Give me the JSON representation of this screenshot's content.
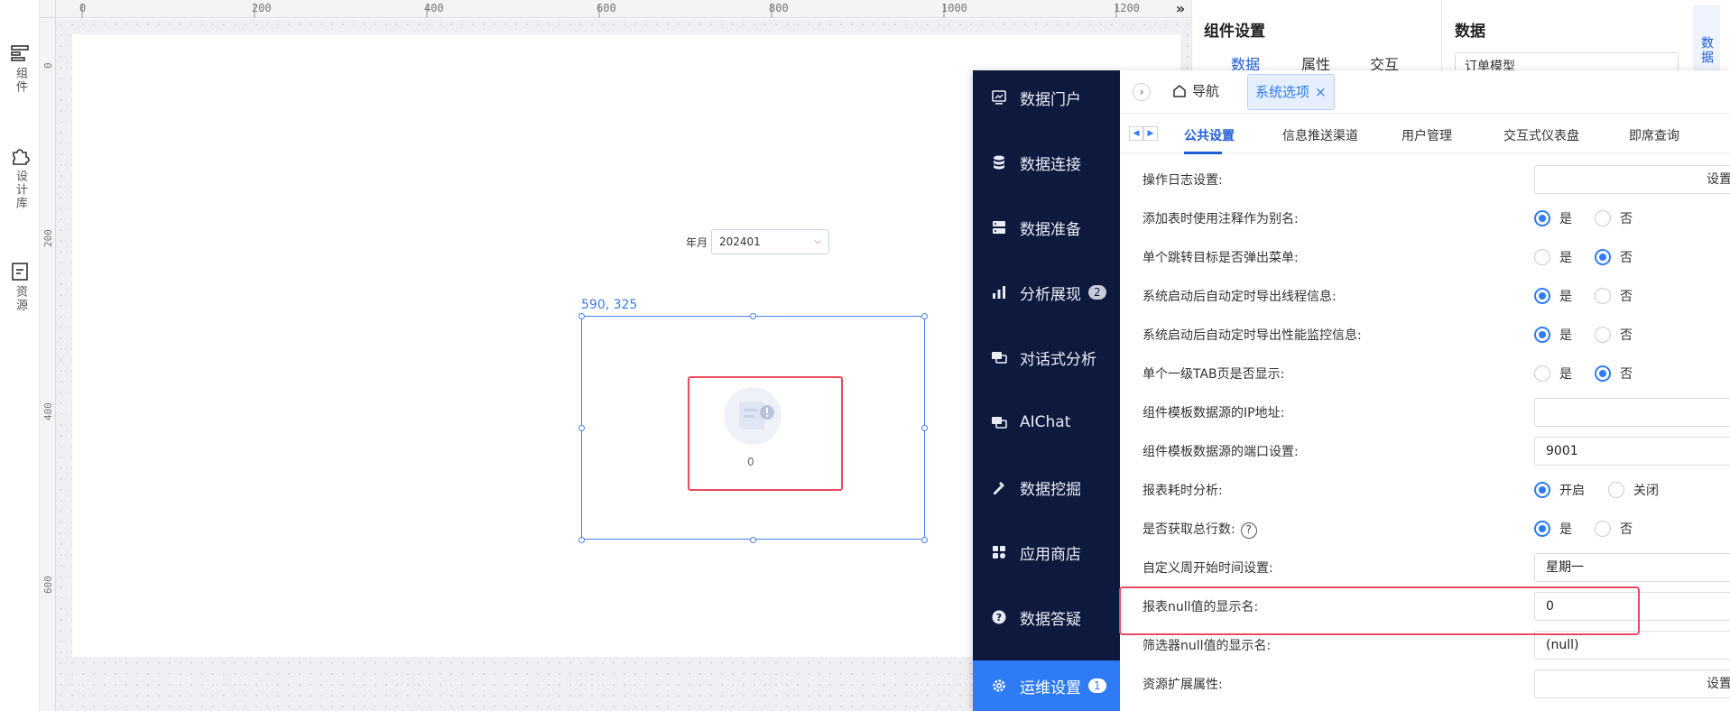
{
  "rail": {
    "items": [
      {
        "label": "组件",
        "icon": "component-icon"
      },
      {
        "label": "设计库",
        "icon": "puzzle-icon"
      },
      {
        "label": "资源",
        "icon": "resource-icon"
      }
    ]
  },
  "ruler": {
    "top_ticks": [
      "0",
      "200",
      "400",
      "600",
      "800",
      "1000",
      "1200"
    ],
    "left_ticks": [
      "0",
      "200",
      "400",
      "600"
    ],
    "collapse": "»"
  },
  "canvas": {
    "filter_label": "年月",
    "filter_value": "202401",
    "coord_readout": "590, 325",
    "widget_value": "0"
  },
  "props": {
    "title": "组件设置",
    "tabs": [
      "数据",
      "属性",
      "交互"
    ],
    "data_title": "数据",
    "data_model": "订单模型",
    "side_tab": "数据"
  },
  "sidenav": {
    "items": [
      {
        "label": "数据门户",
        "icon": "portal-icon",
        "badge": ""
      },
      {
        "label": "数据连接",
        "icon": "database-icon",
        "badge": ""
      },
      {
        "label": "数据准备",
        "icon": "server-icon",
        "badge": ""
      },
      {
        "label": "分析展现",
        "icon": "bar-chart-icon",
        "badge": "2"
      },
      {
        "label": "对话式分析",
        "icon": "chat-icon",
        "badge": ""
      },
      {
        "label": "AIChat",
        "icon": "ai-chat-icon",
        "badge": ""
      },
      {
        "label": "数据挖掘",
        "icon": "pickaxe-icon",
        "badge": ""
      },
      {
        "label": "应用商店",
        "icon": "app-store-icon",
        "badge": ""
      },
      {
        "label": "数据答疑",
        "icon": "question-icon",
        "badge": ""
      },
      {
        "label": "运维设置",
        "icon": "gear-icon",
        "badge": "1"
      }
    ]
  },
  "topbar": {
    "nav_label": "导航",
    "active_tab": "系统选项",
    "close": "×"
  },
  "subtabs": [
    "公共设置",
    "信息推送渠道",
    "用户管理",
    "交互式仪表盘",
    "即席查询"
  ],
  "settings": {
    "op_log": {
      "label": "操作日志设置:",
      "button": "设置"
    },
    "alias": {
      "label": "添加表时使用注释作为别名:",
      "yes": "是",
      "no": "否"
    },
    "jump_menu": {
      "label": "单个跳转目标是否弹出菜单:",
      "yes": "是",
      "no": "否"
    },
    "thread_export": {
      "label": "系统启动后自动定时导出线程信息:",
      "yes": "是",
      "no": "否"
    },
    "perf_export": {
      "label": "系统启动后自动定时导出性能监控信息:",
      "yes": "是",
      "no": "否"
    },
    "single_tab": {
      "label": "单个一级TAB页是否显示:",
      "yes": "是",
      "no": "否"
    },
    "tpl_ip": {
      "label": "组件模板数据源的IP地址:",
      "value": ""
    },
    "tpl_port": {
      "label": "组件模板数据源的端口设置:",
      "value": "9001"
    },
    "timing": {
      "label": "报表耗时分析:",
      "on": "开启",
      "off": "关闭"
    },
    "total_rows": {
      "label": "是否获取总行数:",
      "help": "?",
      "yes": "是",
      "no": "否"
    },
    "week_start": {
      "label": "自定义周开始时间设置:",
      "value": "星期一"
    },
    "report_null": {
      "label": "报表null值的显示名:",
      "value": "0"
    },
    "filter_null": {
      "label": "筛选器null值的显示名:",
      "value": "(null)"
    },
    "resource_ext": {
      "label": "资源扩展属性:",
      "button": "设置"
    }
  },
  "colors": {
    "accent": "#2f7bf5",
    "nav_bg": "#0e1a3d",
    "highlight": "#e84a5f"
  }
}
